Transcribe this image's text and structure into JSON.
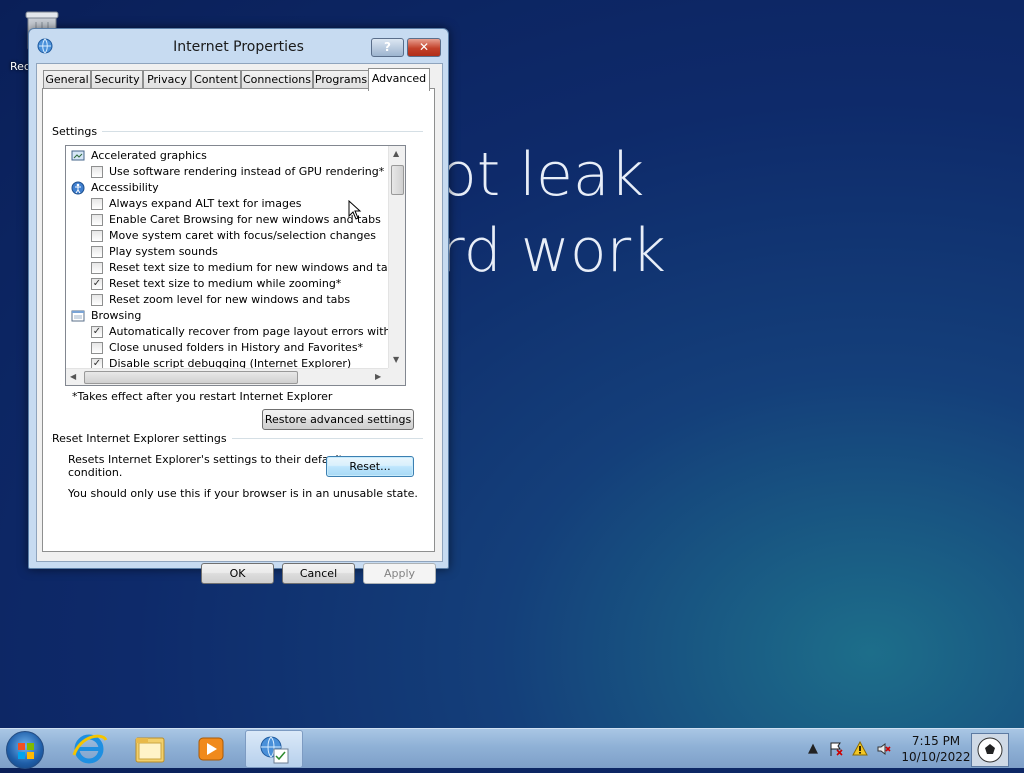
{
  "desktop": {
    "wallpaper_lines": [
      "ot leak",
      "rd work"
    ],
    "recycle_bin_label": "Rec"
  },
  "window": {
    "title": "Internet Properties",
    "help_button": "?",
    "close_button": "✕",
    "tabs": [
      "General",
      "Security",
      "Privacy",
      "Content",
      "Connections",
      "Programs",
      "Advanced"
    ],
    "active_tab": "Advanced",
    "settings_group": "Settings",
    "settings_rows": [
      {
        "type": "category",
        "label": "Accelerated graphics",
        "icon": "monitor-icon"
      },
      {
        "type": "checkbox",
        "label": "Use software rendering instead of GPU rendering*",
        "checked": false
      },
      {
        "type": "category",
        "label": "Accessibility",
        "icon": "accessibility-icon"
      },
      {
        "type": "checkbox",
        "label": "Always expand ALT text for images",
        "checked": false
      },
      {
        "type": "checkbox",
        "label": "Enable Caret Browsing for new windows and tabs",
        "checked": false
      },
      {
        "type": "checkbox",
        "label": "Move system caret with focus/selection changes",
        "checked": false
      },
      {
        "type": "checkbox",
        "label": "Play system sounds",
        "checked": false
      },
      {
        "type": "checkbox",
        "label": "Reset text size to medium for new windows and tabs",
        "checked": false
      },
      {
        "type": "checkbox",
        "label": "Reset text size to medium while zooming*",
        "checked": true
      },
      {
        "type": "checkbox",
        "label": "Reset zoom level for new windows and tabs",
        "checked": false
      },
      {
        "type": "category",
        "label": "Browsing",
        "icon": "window-icon"
      },
      {
        "type": "checkbox",
        "label": "Automatically recover from page layout errors with Compa",
        "checked": true
      },
      {
        "type": "checkbox",
        "label": "Close unused folders in History and Favorites*",
        "checked": false
      },
      {
        "type": "checkbox",
        "label": "Disable script debugging (Internet Explorer)",
        "checked": true
      }
    ],
    "restart_note": "*Takes effect after you restart Internet Explorer",
    "restore_button": "Restore advanced settings",
    "reset_group": "Reset Internet Explorer settings",
    "reset_desc_line1": "Resets Internet Explorer's settings to their default",
    "reset_desc_line2": "condition.",
    "reset_button": "Reset...",
    "reset_warning": "You should only use this if your browser is in an unusable state.",
    "ok_button": "OK",
    "cancel_button": "Cancel",
    "apply_button": "Apply"
  },
  "taskbar": {
    "pinned": [
      "start-orb",
      "internet-explorer-icon",
      "file-explorer-icon",
      "media-player-icon",
      "internet-options-icon"
    ],
    "clock_time": "7:15 PM",
    "clock_date": "10/10/2022"
  }
}
